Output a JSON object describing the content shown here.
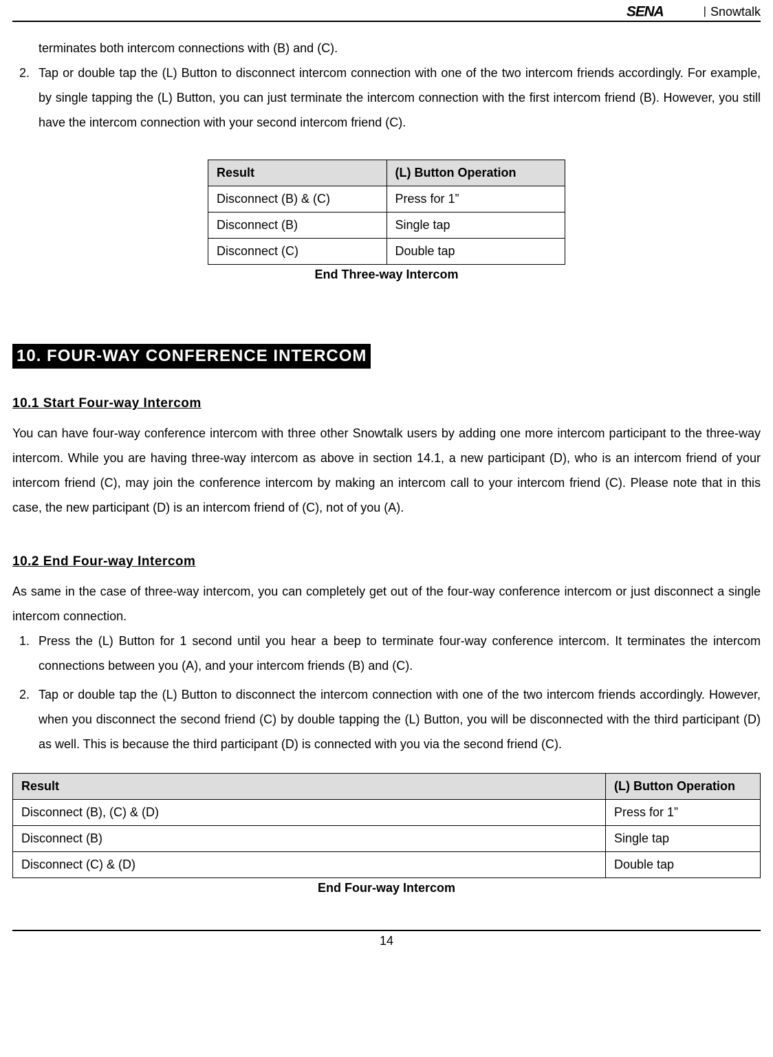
{
  "header": {
    "product": "Snowtalk"
  },
  "intro": {
    "continuation": "terminates both intercom connections with (B) and (C).",
    "item2_num": "2.",
    "item2_text": "Tap or double tap the (L) Button to disconnect intercom connection with one of the two intercom friends accordingly. For example, by single tapping the (L) Button, you can just terminate the intercom connection with the first intercom friend (B). However, you still have the intercom connection with your second intercom friend (C)."
  },
  "table1": {
    "headers": [
      "Result",
      "(L) Button Operation"
    ],
    "rows": [
      [
        "Disconnect (B) & (C)",
        "Press for 1”"
      ],
      [
        "Disconnect (B)",
        "Single tap"
      ],
      [
        "Disconnect (C)",
        "Double tap"
      ]
    ],
    "caption": "End Three-way Intercom"
  },
  "section10": {
    "title": "10. FOUR-WAY CONFERENCE INTERCOM",
    "sub101": {
      "title": "10.1 Start Four-way Intercom",
      "para": "You can have four-way conference intercom with three other Snowtalk users by adding one more intercom participant to the three-way intercom. While you are having three-way intercom as above in section 14.1, a new participant (D), who is an intercom friend of your intercom friend (C), may join the conference intercom by making an intercom call to your intercom friend (C). Please note that in this case, the new participant (D) is an intercom friend of (C), not of you (A)."
    },
    "sub102": {
      "title": "10.2 End Four-way Intercom",
      "para": "As same in the case of three-way intercom, you can completely get out of the four-way conference intercom or just disconnect a single intercom connection.",
      "item1_num": "1.",
      "item1_text": "Press the (L) Button for 1 second until you hear a beep to terminate four-way conference intercom. It terminates the intercom connections between you (A), and your intercom friends (B) and (C).",
      "item2_num": "2.",
      "item2_text": "Tap or double tap the (L) Button to disconnect the intercom connection with one of the two intercom friends accordingly. However, when you disconnect the second friend (C) by double tapping the (L) Button, you will be disconnected with the third participant (D) as well. This is because the third participant (D) is connected with you via the second friend (C)."
    }
  },
  "table2": {
    "headers": [
      "Result",
      "(L) Button Operation"
    ],
    "rows": [
      [
        "Disconnect (B), (C) & (D)",
        "Press for 1”"
      ],
      [
        "Disconnect (B)",
        "Single tap"
      ],
      [
        "Disconnect (C) & (D)",
        "Double tap"
      ]
    ],
    "caption": "End Four-way Intercom"
  },
  "chart_data": [
    {
      "type": "table",
      "title": "End Three-way Intercom",
      "columns": [
        "Result",
        "(L) Button Operation"
      ],
      "rows": [
        [
          "Disconnect (B) & (C)",
          "Press for 1”"
        ],
        [
          "Disconnect (B)",
          "Single tap"
        ],
        [
          "Disconnect (C)",
          "Double tap"
        ]
      ]
    },
    {
      "type": "table",
      "title": "End Four-way Intercom",
      "columns": [
        "Result",
        "(L) Button Operation"
      ],
      "rows": [
        [
          "Disconnect (B), (C) & (D)",
          "Press for 1”"
        ],
        [
          "Disconnect (B)",
          "Single tap"
        ],
        [
          "Disconnect (C) & (D)",
          "Double tap"
        ]
      ]
    }
  ],
  "footer": {
    "page_number": "14"
  }
}
